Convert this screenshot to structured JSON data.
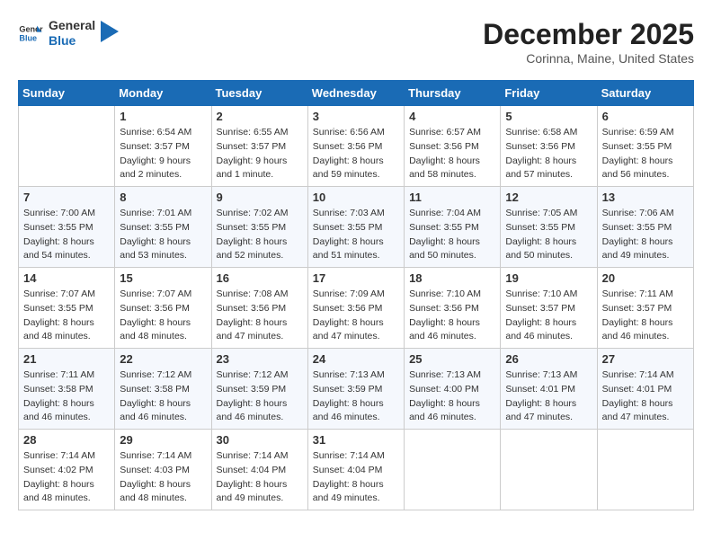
{
  "logo": {
    "text_general": "General",
    "text_blue": "Blue"
  },
  "title": "December 2025",
  "location": "Corinna, Maine, United States",
  "headers": [
    "Sunday",
    "Monday",
    "Tuesday",
    "Wednesday",
    "Thursday",
    "Friday",
    "Saturday"
  ],
  "weeks": [
    [
      {
        "day": "",
        "sunrise": "",
        "sunset": "",
        "daylight": ""
      },
      {
        "day": "1",
        "sunrise": "Sunrise: 6:54 AM",
        "sunset": "Sunset: 3:57 PM",
        "daylight": "Daylight: 9 hours and 2 minutes."
      },
      {
        "day": "2",
        "sunrise": "Sunrise: 6:55 AM",
        "sunset": "Sunset: 3:57 PM",
        "daylight": "Daylight: 9 hours and 1 minute."
      },
      {
        "day": "3",
        "sunrise": "Sunrise: 6:56 AM",
        "sunset": "Sunset: 3:56 PM",
        "daylight": "Daylight: 8 hours and 59 minutes."
      },
      {
        "day": "4",
        "sunrise": "Sunrise: 6:57 AM",
        "sunset": "Sunset: 3:56 PM",
        "daylight": "Daylight: 8 hours and 58 minutes."
      },
      {
        "day": "5",
        "sunrise": "Sunrise: 6:58 AM",
        "sunset": "Sunset: 3:56 PM",
        "daylight": "Daylight: 8 hours and 57 minutes."
      },
      {
        "day": "6",
        "sunrise": "Sunrise: 6:59 AM",
        "sunset": "Sunset: 3:55 PM",
        "daylight": "Daylight: 8 hours and 56 minutes."
      }
    ],
    [
      {
        "day": "7",
        "sunrise": "Sunrise: 7:00 AM",
        "sunset": "Sunset: 3:55 PM",
        "daylight": "Daylight: 8 hours and 54 minutes."
      },
      {
        "day": "8",
        "sunrise": "Sunrise: 7:01 AM",
        "sunset": "Sunset: 3:55 PM",
        "daylight": "Daylight: 8 hours and 53 minutes."
      },
      {
        "day": "9",
        "sunrise": "Sunrise: 7:02 AM",
        "sunset": "Sunset: 3:55 PM",
        "daylight": "Daylight: 8 hours and 52 minutes."
      },
      {
        "day": "10",
        "sunrise": "Sunrise: 7:03 AM",
        "sunset": "Sunset: 3:55 PM",
        "daylight": "Daylight: 8 hours and 51 minutes."
      },
      {
        "day": "11",
        "sunrise": "Sunrise: 7:04 AM",
        "sunset": "Sunset: 3:55 PM",
        "daylight": "Daylight: 8 hours and 50 minutes."
      },
      {
        "day": "12",
        "sunrise": "Sunrise: 7:05 AM",
        "sunset": "Sunset: 3:55 PM",
        "daylight": "Daylight: 8 hours and 50 minutes."
      },
      {
        "day": "13",
        "sunrise": "Sunrise: 7:06 AM",
        "sunset": "Sunset: 3:55 PM",
        "daylight": "Daylight: 8 hours and 49 minutes."
      }
    ],
    [
      {
        "day": "14",
        "sunrise": "Sunrise: 7:07 AM",
        "sunset": "Sunset: 3:55 PM",
        "daylight": "Daylight: 8 hours and 48 minutes."
      },
      {
        "day": "15",
        "sunrise": "Sunrise: 7:07 AM",
        "sunset": "Sunset: 3:56 PM",
        "daylight": "Daylight: 8 hours and 48 minutes."
      },
      {
        "day": "16",
        "sunrise": "Sunrise: 7:08 AM",
        "sunset": "Sunset: 3:56 PM",
        "daylight": "Daylight: 8 hours and 47 minutes."
      },
      {
        "day": "17",
        "sunrise": "Sunrise: 7:09 AM",
        "sunset": "Sunset: 3:56 PM",
        "daylight": "Daylight: 8 hours and 47 minutes."
      },
      {
        "day": "18",
        "sunrise": "Sunrise: 7:10 AM",
        "sunset": "Sunset: 3:56 PM",
        "daylight": "Daylight: 8 hours and 46 minutes."
      },
      {
        "day": "19",
        "sunrise": "Sunrise: 7:10 AM",
        "sunset": "Sunset: 3:57 PM",
        "daylight": "Daylight: 8 hours and 46 minutes."
      },
      {
        "day": "20",
        "sunrise": "Sunrise: 7:11 AM",
        "sunset": "Sunset: 3:57 PM",
        "daylight": "Daylight: 8 hours and 46 minutes."
      }
    ],
    [
      {
        "day": "21",
        "sunrise": "Sunrise: 7:11 AM",
        "sunset": "Sunset: 3:58 PM",
        "daylight": "Daylight: 8 hours and 46 minutes."
      },
      {
        "day": "22",
        "sunrise": "Sunrise: 7:12 AM",
        "sunset": "Sunset: 3:58 PM",
        "daylight": "Daylight: 8 hours and 46 minutes."
      },
      {
        "day": "23",
        "sunrise": "Sunrise: 7:12 AM",
        "sunset": "Sunset: 3:59 PM",
        "daylight": "Daylight: 8 hours and 46 minutes."
      },
      {
        "day": "24",
        "sunrise": "Sunrise: 7:13 AM",
        "sunset": "Sunset: 3:59 PM",
        "daylight": "Daylight: 8 hours and 46 minutes."
      },
      {
        "day": "25",
        "sunrise": "Sunrise: 7:13 AM",
        "sunset": "Sunset: 4:00 PM",
        "daylight": "Daylight: 8 hours and 46 minutes."
      },
      {
        "day": "26",
        "sunrise": "Sunrise: 7:13 AM",
        "sunset": "Sunset: 4:01 PM",
        "daylight": "Daylight: 8 hours and 47 minutes."
      },
      {
        "day": "27",
        "sunrise": "Sunrise: 7:14 AM",
        "sunset": "Sunset: 4:01 PM",
        "daylight": "Daylight: 8 hours and 47 minutes."
      }
    ],
    [
      {
        "day": "28",
        "sunrise": "Sunrise: 7:14 AM",
        "sunset": "Sunset: 4:02 PM",
        "daylight": "Daylight: 8 hours and 48 minutes."
      },
      {
        "day": "29",
        "sunrise": "Sunrise: 7:14 AM",
        "sunset": "Sunset: 4:03 PM",
        "daylight": "Daylight: 8 hours and 48 minutes."
      },
      {
        "day": "30",
        "sunrise": "Sunrise: 7:14 AM",
        "sunset": "Sunset: 4:04 PM",
        "daylight": "Daylight: 8 hours and 49 minutes."
      },
      {
        "day": "31",
        "sunrise": "Sunrise: 7:14 AM",
        "sunset": "Sunset: 4:04 PM",
        "daylight": "Daylight: 8 hours and 49 minutes."
      },
      {
        "day": "",
        "sunrise": "",
        "sunset": "",
        "daylight": ""
      },
      {
        "day": "",
        "sunrise": "",
        "sunset": "",
        "daylight": ""
      },
      {
        "day": "",
        "sunrise": "",
        "sunset": "",
        "daylight": ""
      }
    ]
  ]
}
